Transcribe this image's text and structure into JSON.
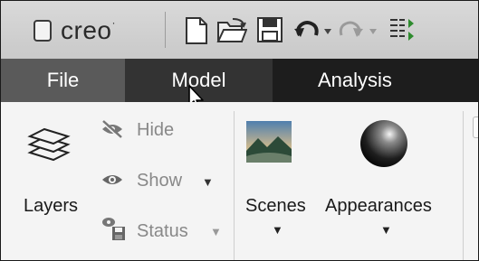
{
  "app": {
    "logo_text": "creo",
    "logo_mark": "·"
  },
  "toolbar": {
    "icons": [
      "new-file-icon",
      "open-folder-icon",
      "save-icon",
      "undo-icon",
      "redo-icon",
      "regenerate-icon"
    ]
  },
  "tabs": [
    {
      "label": "File",
      "active": false
    },
    {
      "label": "Model",
      "active": true
    },
    {
      "label": "Analysis",
      "active": false
    }
  ],
  "ribbon": {
    "layers_label": "Layers",
    "hide_label": "Hide",
    "show_label": "Show",
    "status_label": "Status",
    "scenes_label": "Scenes",
    "appearances_label": "Appearances",
    "dropdown_caret": "▼"
  },
  "colors": {
    "file_tab": "#5a5a5a",
    "model_tab": "#333333",
    "tab_bar": "#1d1d1d",
    "toolbar": "#d3d3d3",
    "ribbon": "#f4f4f4",
    "disabled_text": "#888888"
  }
}
